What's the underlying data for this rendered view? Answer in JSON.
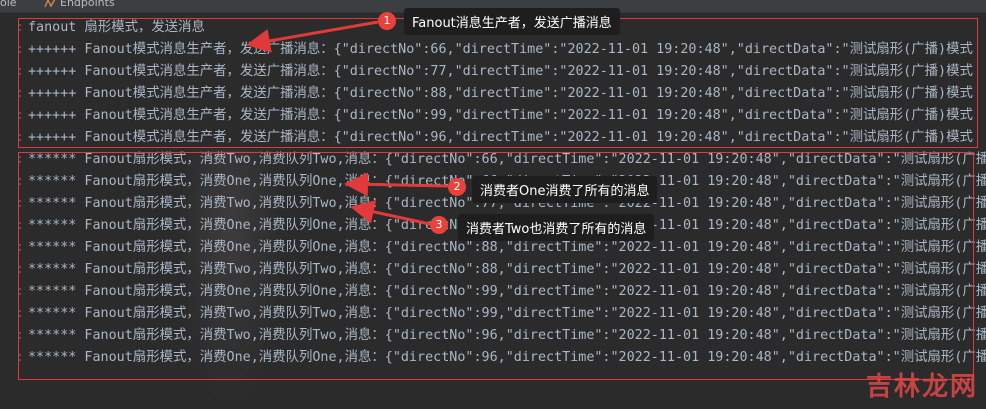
{
  "tabs": {
    "left_label": "ole",
    "endpoints_label": "Endpoints"
  },
  "console": {
    "header": "fanout 扇形模式，发送消息",
    "producer_lines": [
      "++++++ Fanout模式消息生产者，发送广播消息：{\"directNo\":66,\"directTime\":\"2022-11-01 19:20:48\",\"directData\":\"测试扇形(广播)模式",
      "++++++ Fanout模式消息生产者，发送广播消息：{\"directNo\":77,\"directTime\":\"2022-11-01 19:20:48\",\"directData\":\"测试扇形(广播)模式",
      "++++++ Fanout模式消息生产者，发送广播消息：{\"directNo\":88,\"directTime\":\"2022-11-01 19:20:48\",\"directData\":\"测试扇形(广播)模式",
      "++++++ Fanout模式消息生产者，发送广播消息：{\"directNo\":99,\"directTime\":\"2022-11-01 19:20:48\",\"directData\":\"测试扇形(广播)模式",
      "++++++ Fanout模式消息生产者，发送广播消息：{\"directNo\":96,\"directTime\":\"2022-11-01 19:20:48\",\"directData\":\"测试扇形(广播)模式"
    ],
    "consumer_lines": [
      "****** Fanout扇形模式，消费Two,消费队列Two,消息：{\"directNo\":66,\"directTime\":\"2022-11-01 19:20:48\",\"directData\":\"测试扇形(广播",
      "****** Fanout扇形模式，消费One,消费队列One,消息：{\"directNo\":66,\"directTime\":\"2022-11-01 19:20:48\",\"directData\":\"测试扇形(广播",
      "****** Fanout扇形模式，消费Two,消费队列Two,消息：{\"directNo\":77,\"directTime\":\"2022-11-01 19:20:48\",\"directData\":\"测试扇形(广播",
      "****** Fanout扇形模式，消费One,消费队列One,消息：{\"directNo\":77,\"directTime\":\"2022-11-01 19:20:48\",\"directData\":\"测试扇形(广播",
      "****** Fanout扇形模式，消费One,消费队列One,消息：{\"directNo\":88,\"directTime\":\"2022-11-01 19:20:48\",\"directData\":\"测试扇形(广播",
      "****** Fanout扇形模式，消费Two,消费队列Two,消息：{\"directNo\":88,\"directTime\":\"2022-11-01 19:20:48\",\"directData\":\"测试扇形(广播",
      "****** Fanout扇形模式，消费One,消费队列One,消息：{\"directNo\":99,\"directTime\":\"2022-11-01 19:20:48\",\"directData\":\"测试扇形(广播",
      "****** Fanout扇形模式，消费Two,消费队列Two,消息：{\"directNo\":99,\"directTime\":\"2022-11-01 19:20:48\",\"directData\":\"测试扇形(广播",
      "****** Fanout扇形模式，消费Two,消费队列Two,消息：{\"directNo\":96,\"directTime\":\"2022-11-01 19:20:48\",\"directData\":\"测试扇形(广播",
      "****** Fanout扇形模式，消费One,消费队列One,消息：{\"directNo\":96,\"directTime\":\"2022-11-01 19:20:48\",\"directData\":\"测试扇形(广播"
    ]
  },
  "annotations": [
    {
      "number": "1",
      "text": "Fanout消息生产者，发送广播消息"
    },
    {
      "number": "2",
      "text": "消费者One消费了所有的消息"
    },
    {
      "number": "3",
      "text": "消费者Two也消费了所有的消息"
    }
  ],
  "watermark": {
    "text": "吉林龙网",
    "sub": ""
  },
  "colors": {
    "background": "#2b2b2b",
    "text": "#a9b7c6",
    "annotation_red": "#e23a3a",
    "callout_bg": "#1e1e1e"
  }
}
